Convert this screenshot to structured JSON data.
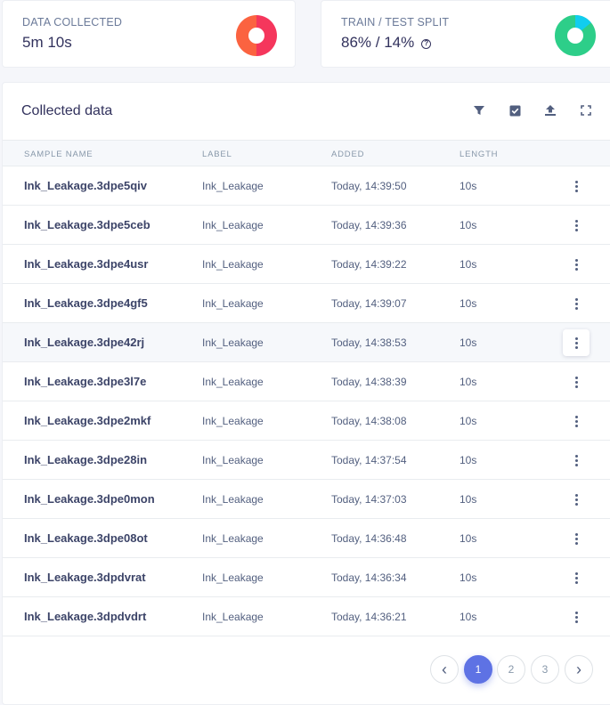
{
  "stats": {
    "data_collected": {
      "label": "DATA COLLECTED",
      "value": "5m 10s"
    },
    "split": {
      "label": "TRAIN / TEST SPLIT",
      "value": "86% / 14%",
      "help_glyph": "?",
      "train_fraction": 0.86
    }
  },
  "colors": {
    "donut_red": "#f5365c",
    "donut_orange": "#fb6340",
    "donut_green": "#2dce89",
    "donut_cyan": "#11cdef",
    "accent": "#5e72e4"
  },
  "main": {
    "title": "Collected data",
    "tools": [
      "filter-icon",
      "select-icon",
      "upload-icon",
      "fullscreen-icon"
    ],
    "columns": [
      "SAMPLE NAME",
      "LABEL",
      "ADDED",
      "LENGTH"
    ],
    "rows": [
      {
        "name": "Ink_Leakage.3dpe5qiv",
        "label": "Ink_Leakage",
        "added": "Today, 14:39:50",
        "length": "10s"
      },
      {
        "name": "Ink_Leakage.3dpe5ceb",
        "label": "Ink_Leakage",
        "added": "Today, 14:39:36",
        "length": "10s"
      },
      {
        "name": "Ink_Leakage.3dpe4usr",
        "label": "Ink_Leakage",
        "added": "Today, 14:39:22",
        "length": "10s"
      },
      {
        "name": "Ink_Leakage.3dpe4gf5",
        "label": "Ink_Leakage",
        "added": "Today, 14:39:07",
        "length": "10s"
      },
      {
        "name": "Ink_Leakage.3dpe42rj",
        "label": "Ink_Leakage",
        "added": "Today, 14:38:53",
        "length": "10s"
      },
      {
        "name": "Ink_Leakage.3dpe3l7e",
        "label": "Ink_Leakage",
        "added": "Today, 14:38:39",
        "length": "10s"
      },
      {
        "name": "Ink_Leakage.3dpe2mkf",
        "label": "Ink_Leakage",
        "added": "Today, 14:38:08",
        "length": "10s"
      },
      {
        "name": "Ink_Leakage.3dpe28in",
        "label": "Ink_Leakage",
        "added": "Today, 14:37:54",
        "length": "10s"
      },
      {
        "name": "Ink_Leakage.3dpe0mon",
        "label": "Ink_Leakage",
        "added": "Today, 14:37:03",
        "length": "10s"
      },
      {
        "name": "Ink_Leakage.3dpe08ot",
        "label": "Ink_Leakage",
        "added": "Today, 14:36:48",
        "length": "10s"
      },
      {
        "name": "Ink_Leakage.3dpdvrat",
        "label": "Ink_Leakage",
        "added": "Today, 14:36:34",
        "length": "10s"
      },
      {
        "name": "Ink_Leakage.3dpdvdrt",
        "label": "Ink_Leakage",
        "added": "Today, 14:36:21",
        "length": "10s"
      }
    ],
    "hovered_row": 4
  },
  "pagination": {
    "prev_glyph": "‹",
    "next_glyph": "›",
    "pages": [
      "1",
      "2",
      "3"
    ],
    "current": 0
  }
}
